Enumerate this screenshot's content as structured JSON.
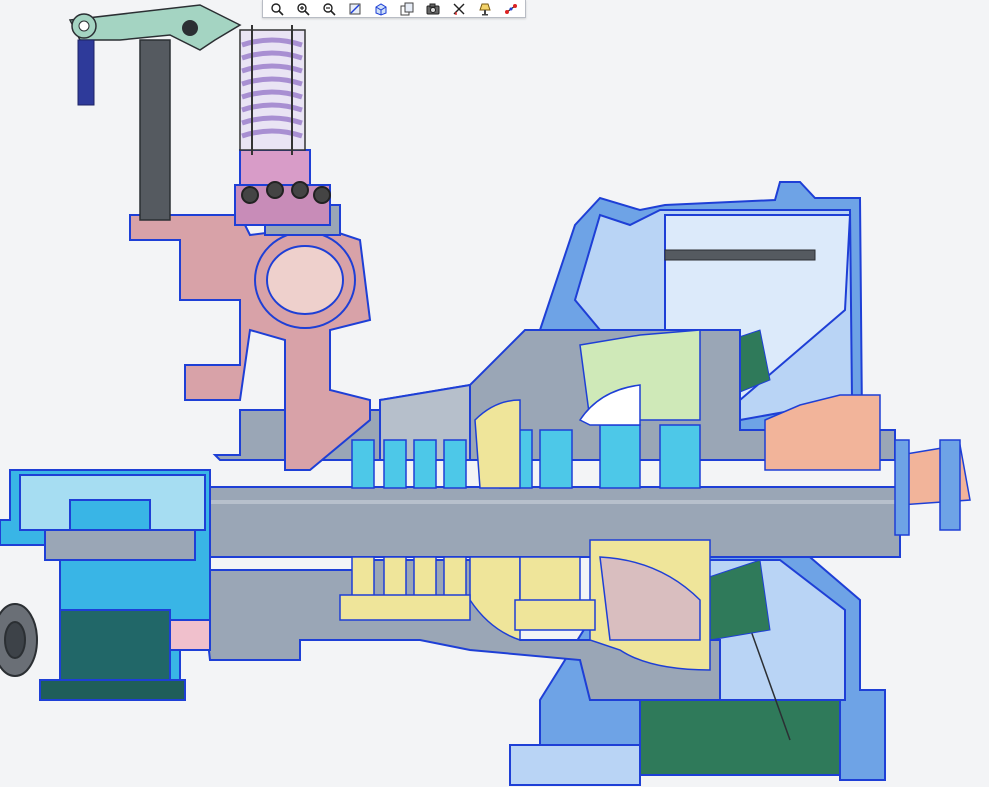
{
  "app": {
    "window_title": ""
  },
  "viewport": {
    "background": "#f3f4f6",
    "model_colors": {
      "casing_outline": "#1e3fd6",
      "casing_fill_blue": "#6ea3e6",
      "casing_fill_light": "#b9d4f5",
      "shaft_gray": "#9aa6b6",
      "pink_valve": "#d8a2a8",
      "spring_purple": "#a88fd2",
      "blade_cyan": "#4dc8e8",
      "blade_yellow": "#efe59a",
      "blade_green": "#cfe9b8",
      "coupling_salmon": "#f2b49a",
      "base_green": "#2f7a5a",
      "bearing_cyan": "#39b5e6",
      "dark_teal": "#1f5e5a"
    }
  },
  "toolbar": {
    "buttons": [
      {
        "id": "zoom-fit",
        "icon": "zoom-fit-icon"
      },
      {
        "id": "zoom-in",
        "icon": "zoom-in-icon"
      },
      {
        "id": "zoom-out",
        "icon": "zoom-out-icon"
      },
      {
        "id": "pan",
        "icon": "pan-icon"
      },
      {
        "id": "view-3d",
        "icon": "cube-view-icon"
      },
      {
        "id": "copy-view",
        "icon": "copy-view-icon"
      },
      {
        "id": "snapshot",
        "icon": "camera-icon"
      },
      {
        "id": "section",
        "icon": "section-cut-icon"
      },
      {
        "id": "lighting",
        "icon": "lamp-icon"
      },
      {
        "id": "connect",
        "icon": "node-link-icon"
      }
    ]
  }
}
